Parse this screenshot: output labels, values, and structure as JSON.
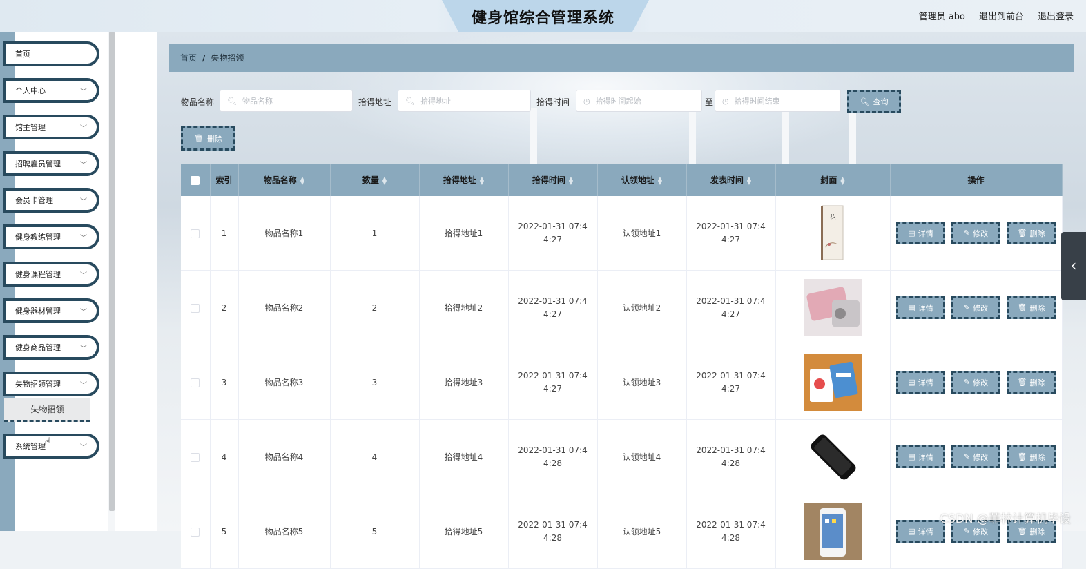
{
  "header": {
    "title": "健身馆综合管理系统",
    "user": "管理员 abo",
    "to_front": "退出到前台",
    "logout": "退出登录"
  },
  "sidebar": {
    "items": [
      {
        "label": "首页",
        "has_arrow": false
      },
      {
        "label": "个人中心",
        "has_arrow": true
      },
      {
        "label": "馆主管理",
        "has_arrow": true
      },
      {
        "label": "招聘雇员管理",
        "has_arrow": true
      },
      {
        "label": "会员卡管理",
        "has_arrow": true
      },
      {
        "label": "健身教练管理",
        "has_arrow": true
      },
      {
        "label": "健身课程管理",
        "has_arrow": true
      },
      {
        "label": "健身器材管理",
        "has_arrow": true
      },
      {
        "label": "健身商品管理",
        "has_arrow": true
      },
      {
        "label": "失物招领管理",
        "has_arrow": true
      },
      {
        "label": "系统管理",
        "has_arrow": true
      }
    ],
    "submenu_item": "失物招领"
  },
  "breadcrumb": {
    "home": "首页",
    "separator": "/",
    "current": "失物招领"
  },
  "search": {
    "name_label": "物品名称",
    "name_placeholder": "物品名称",
    "address_label": "拾得地址",
    "address_placeholder": "拾得地址",
    "time_label": "拾得时间",
    "time_start_placeholder": "拾得时间起始",
    "time_to": "至",
    "time_end_placeholder": "拾得时间结束",
    "query_button": "查询"
  },
  "toolbar": {
    "delete_button": "删除"
  },
  "table": {
    "columns": [
      "索引",
      "物品名称",
      "数量",
      "拾得地址",
      "拾得时间",
      "认领地址",
      "发表时间",
      "封面",
      "操作"
    ],
    "actions": {
      "detail": "详情",
      "edit": "修改",
      "delete": "删除"
    },
    "rows": [
      {
        "index": "1",
        "name": "物品名称1",
        "qty": "1",
        "found_address": "拾得地址1",
        "found_time": "2022-01-31 07:44:27",
        "claim_address": "认领地址1",
        "publish_time": "2022-01-31 07:44:27",
        "cover": "book"
      },
      {
        "index": "2",
        "name": "物品名称2",
        "qty": "2",
        "found_address": "拾得地址2",
        "found_time": "2022-01-31 07:44:27",
        "claim_address": "认领地址2",
        "publish_time": "2022-01-31 07:44:27",
        "cover": "wallet"
      },
      {
        "index": "3",
        "name": "物品名称3",
        "qty": "3",
        "found_address": "拾得地址3",
        "found_time": "2022-01-31 07:44:27",
        "claim_address": "认领地址3",
        "publish_time": "2022-01-31 07:44:27",
        "cover": "cards"
      },
      {
        "index": "4",
        "name": "物品名称4",
        "qty": "4",
        "found_address": "拾得地址4",
        "found_time": "2022-01-31 07:44:28",
        "claim_address": "认领地址4",
        "publish_time": "2022-01-31 07:44:28",
        "cover": "phone-black"
      },
      {
        "index": "5",
        "name": "物品名称5",
        "qty": "5",
        "found_address": "拾得地址5",
        "found_time": "2022-01-31 07:44:28",
        "claim_address": "认领地址5",
        "publish_time": "2022-01-31 07:44:28",
        "cover": "phone-white"
      }
    ]
  },
  "watermark": "CSDN @菲林计算机毕设",
  "colors": {
    "accent": "#8aa9bd",
    "accent_dark": "#284a5e"
  }
}
